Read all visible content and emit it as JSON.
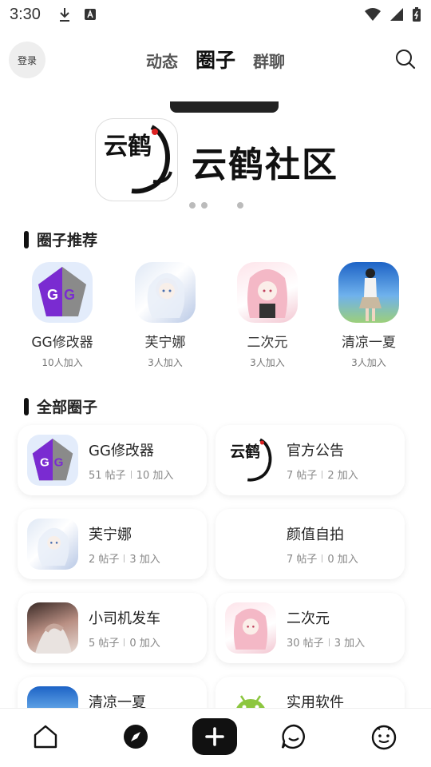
{
  "status_bar": {
    "time": "3:30"
  },
  "header": {
    "login_label": "登录",
    "tabs": [
      {
        "label": "动态",
        "active": false
      },
      {
        "label": "圈子",
        "active": true
      },
      {
        "label": "群聊",
        "active": false
      }
    ]
  },
  "banner": {
    "text": "云鹤社区",
    "logo_text": "云鹤",
    "dots": 3
  },
  "recommend": {
    "title": "圈子推荐",
    "items": [
      {
        "name": "GG修改器",
        "count": "10人加入",
        "avatar": "gg-logo"
      },
      {
        "name": "芙宁娜",
        "count": "3人加入",
        "avatar": "anime-girl-blue"
      },
      {
        "name": "二次元",
        "count": "3人加入",
        "avatar": "anime-girl-pink"
      },
      {
        "name": "清凉一夏",
        "count": "3人加入",
        "avatar": "summer-photo"
      }
    ]
  },
  "all_circles": {
    "title": "全部圈子",
    "items": [
      {
        "name": "GG修改器",
        "posts": "51 帖子",
        "joins": "10 加入",
        "avatar": "gg-logo"
      },
      {
        "name": "官方公告",
        "posts": "7 帖子",
        "joins": "2 加入",
        "avatar": "crane-logo"
      },
      {
        "name": "芙宁娜",
        "posts": "2 帖子",
        "joins": "3 加入",
        "avatar": "anime-girl-blue"
      },
      {
        "name": "颜值自拍",
        "posts": "7 帖子",
        "joins": "0 加入",
        "avatar": "blank"
      },
      {
        "name": "小司机发车",
        "posts": "5 帖子",
        "joins": "0 加入",
        "avatar": "photo-legs"
      },
      {
        "name": "二次元",
        "posts": "30 帖子",
        "joins": "3 加入",
        "avatar": "anime-girl-pink"
      },
      {
        "name": "清凉一夏",
        "posts": "",
        "joins": "",
        "avatar": "summer-photo"
      },
      {
        "name": "实用软件",
        "posts": "",
        "joins": "",
        "avatar": "android-logo"
      }
    ]
  },
  "bottom_nav": {
    "items": [
      "home-icon",
      "compass-icon",
      "add-icon",
      "message-icon",
      "face-icon"
    ]
  },
  "colors": {
    "accent": "#111111",
    "gg_purple": "#7a2bd1",
    "card_shadow": "#eeeeee"
  }
}
